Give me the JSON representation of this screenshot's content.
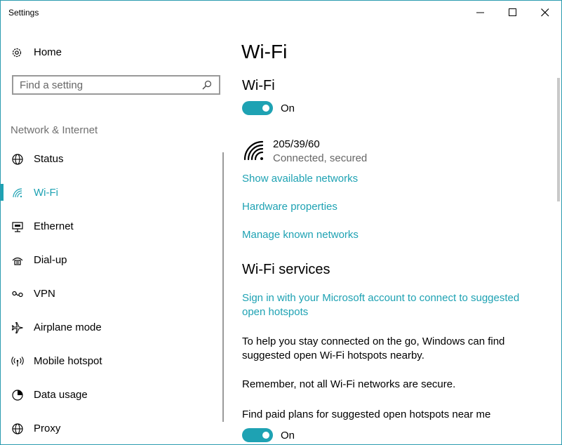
{
  "window": {
    "title": "Settings"
  },
  "sidebar": {
    "home_label": "Home",
    "search_placeholder": "Find a setting",
    "section_label": "Network & Internet",
    "items": [
      {
        "label": "Status",
        "icon": "globe-icon"
      },
      {
        "label": "Wi-Fi",
        "icon": "wifi-icon",
        "active": true
      },
      {
        "label": "Ethernet",
        "icon": "ethernet-icon"
      },
      {
        "label": "Dial-up",
        "icon": "dialup-icon"
      },
      {
        "label": "VPN",
        "icon": "vpn-icon"
      },
      {
        "label": "Airplane mode",
        "icon": "airplane-icon"
      },
      {
        "label": "Mobile hotspot",
        "icon": "hotspot-icon"
      },
      {
        "label": "Data usage",
        "icon": "data-usage-icon"
      },
      {
        "label": "Proxy",
        "icon": "globe-icon"
      }
    ]
  },
  "main": {
    "page_title": "Wi-Fi",
    "wifi_section_title": "Wi-Fi",
    "wifi_toggle_state": "On",
    "network": {
      "name": "205/39/60",
      "status": "Connected, secured"
    },
    "links": {
      "show_networks": "Show available networks",
      "hardware_properties": "Hardware properties",
      "manage_networks": "Manage known networks"
    },
    "services_title": "Wi-Fi services",
    "sign_in_link": "Sign in with your Microsoft account to connect to suggested open hotspots",
    "help_text": "To help you stay connected on the go, Windows can find suggested open Wi-Fi hotspots nearby.",
    "remember_text": "Remember, not all Wi-Fi networks are secure.",
    "paid_plans_label": "Find paid plans for suggested open hotspots near me",
    "paid_toggle_state": "On"
  },
  "colors": {
    "accent": "#1ea2b3",
    "border": "#2b9bb0",
    "muted_text": "#707070"
  }
}
